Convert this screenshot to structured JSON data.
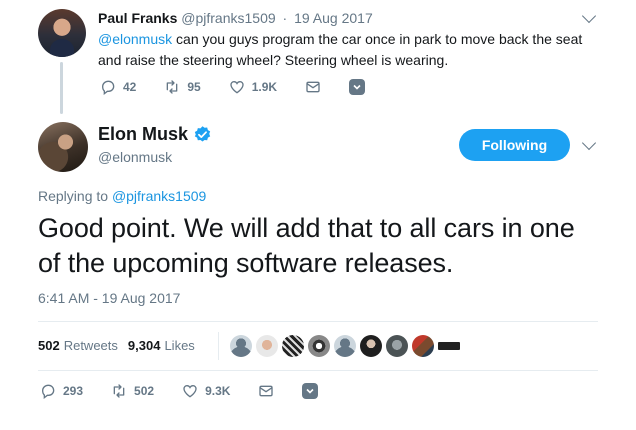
{
  "parent_tweet": {
    "name": "Paul Franks",
    "handle": "@pjfranks1509",
    "separator": "·",
    "date": "19 Aug 2017",
    "mention": "@elonmusk",
    "text": " can you guys program the car once in park to move back the seat and raise the steering wheel? Steering wheel is wearing.",
    "replies": "42",
    "retweets": "95",
    "likes": "1.9K"
  },
  "main_tweet": {
    "name": "Elon Musk",
    "handle": "@elonmusk",
    "follow_label": "Following",
    "replying_prefix": "Replying to ",
    "replying_to": "@pjfranks1509",
    "text": "Good point. We will add that to all cars in one of the upcoming software releases.",
    "timestamp": "6:41 AM - 19 Aug 2017",
    "retweets_count": "502",
    "retweets_label": "Retweets",
    "likes_count": "9,304",
    "likes_label": "Likes",
    "replies": "293",
    "retweets": "502",
    "likes": "9.3K"
  },
  "colors": {
    "accent": "#1da1f2",
    "link": "#1b95e0",
    "muted": "#657786"
  },
  "icons": [
    "reply-icon",
    "retweet-icon",
    "heart-icon",
    "mail-icon",
    "more-options-icon",
    "verified-badge-icon",
    "chevron-down-icon"
  ]
}
